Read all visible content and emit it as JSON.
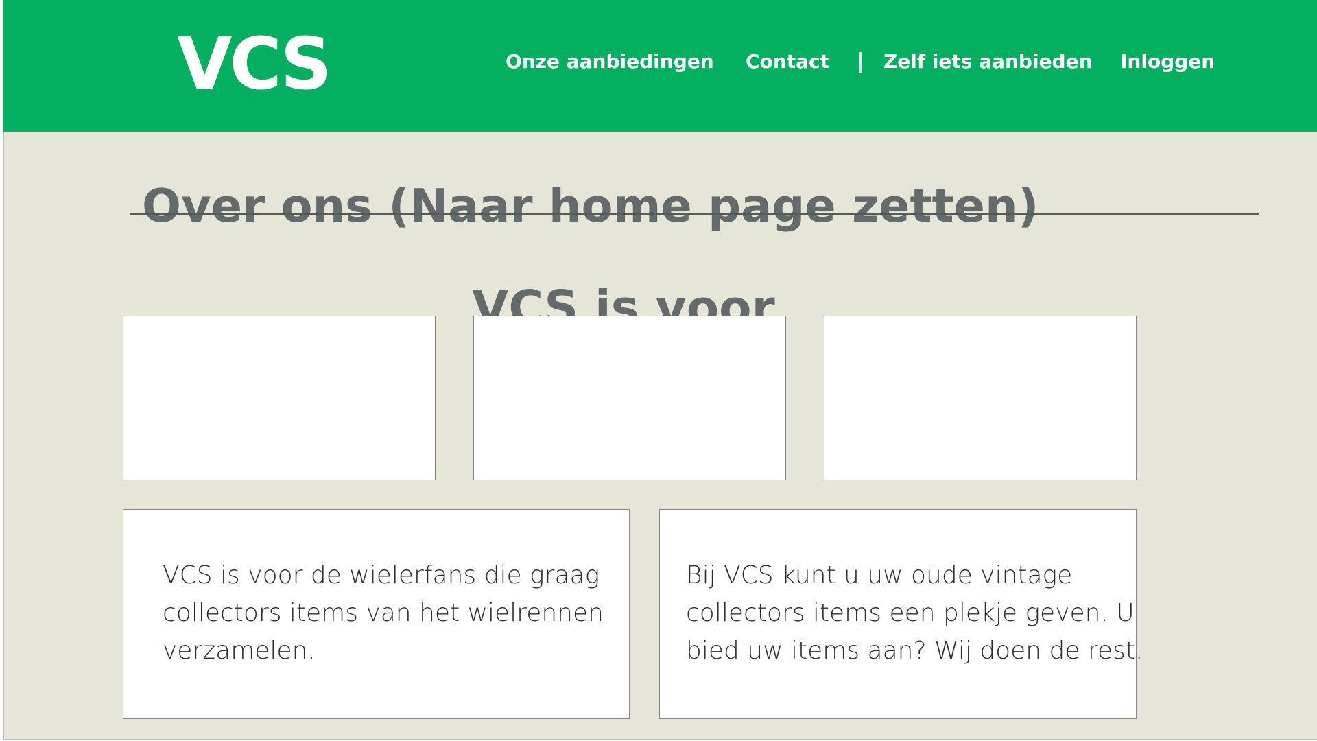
{
  "header": {
    "logo": "VCS",
    "nav": [
      {
        "label": "Onze aanbiedingen"
      },
      {
        "label": "Contact"
      },
      {
        "label": "Zelf iets aanbieden"
      },
      {
        "label": "Inloggen"
      }
    ],
    "separator": "|"
  },
  "main": {
    "page_title": "Over ons (Naar home page zetten)",
    "section_title": "VCS is voor",
    "info_texts": [
      "VCS is voor de wielerfans die graag collectors items van het wielrennen verzamelen.",
      "Bij VCS kunt u uw oude vintage collectors items een plekje geven. U bied uw items aan? Wij doen de rest."
    ]
  },
  "colors": {
    "brand_green": "#04af60",
    "background": "#e5e5d8",
    "heading_gray": "#656b6b"
  }
}
